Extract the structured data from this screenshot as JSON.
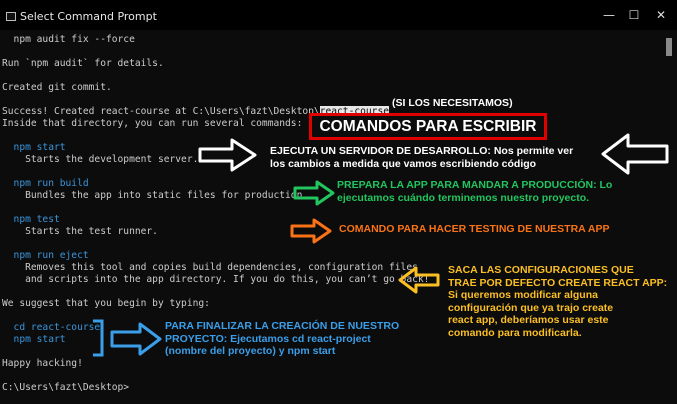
{
  "window": {
    "title": "Select Command Prompt",
    "minimize": "—",
    "maximize": "☐",
    "close": "✕"
  },
  "terminal": {
    "lines": [
      {
        "text": "  npm audit fix --force",
        "type": "out"
      },
      {
        "text": "",
        "type": "blank"
      },
      {
        "text": "Run `npm audit` for details.",
        "type": "out"
      },
      {
        "text": "",
        "type": "blank"
      },
      {
        "text": "Created git commit.",
        "type": "out"
      },
      {
        "text": "",
        "type": "blank"
      },
      {
        "text": "Success! Created react-course at C:\\Users\\fazt\\Desktop\\",
        "type": "out",
        "selected": "react-course"
      },
      {
        "text": "Inside that directory, you can run several commands:",
        "type": "out"
      },
      {
        "text": "",
        "type": "blank"
      },
      {
        "text": "  npm start",
        "type": "cmd"
      },
      {
        "text": "    Starts the development server.",
        "type": "out"
      },
      {
        "text": "",
        "type": "blank"
      },
      {
        "text": "  npm run build",
        "type": "cmd"
      },
      {
        "text": "    Bundles the app into static files for production.",
        "type": "out"
      },
      {
        "text": "",
        "type": "blank"
      },
      {
        "text": "  npm test",
        "type": "cmd"
      },
      {
        "text": "    Starts the test runner.",
        "type": "out"
      },
      {
        "text": "",
        "type": "blank"
      },
      {
        "text": "  npm run eject",
        "type": "cmd"
      },
      {
        "text": "    Removes this tool and copies build dependencies, configuration files",
        "type": "out"
      },
      {
        "text": "    and scripts into the app directory. If you do this, you can’t go back!",
        "type": "out"
      },
      {
        "text": "",
        "type": "blank"
      },
      {
        "text": "We suggest that you begin by typing:",
        "type": "out"
      },
      {
        "text": "",
        "type": "blank"
      },
      {
        "text": "  cd react-course",
        "type": "cmd"
      },
      {
        "text": "  npm start",
        "type": "cmd"
      },
      {
        "text": "",
        "type": "blank"
      },
      {
        "text": "Happy hacking!",
        "type": "out"
      },
      {
        "text": "",
        "type": "blank"
      },
      {
        "text": "C:\\Users\\fazt\\Desktop>",
        "type": "out"
      }
    ]
  },
  "annotations": {
    "optional_note": "(SI LOS NECESITAMOS)",
    "title": "COMANDOS PARA ESCRIBIR",
    "start_note": [
      "EJECUTA UN SERVIDOR DE DESARROLLO: Nos permite ver",
      "los cambios a medida que vamos escribiendo código"
    ],
    "build_note": [
      "PREPARA LA APP PARA MANDAR A PRODUCCIÓN: Lo",
      "ejecutamos cuándo terminemos nuestro proyecto."
    ],
    "test_note": [
      "COMANDO PARA HACER TESTING DE NUESTRA APP"
    ],
    "eject_note": [
      "SACA LAS CONFIGURACIONES QUE",
      "TRAE POR DEFECTO CREATE REACT APP:",
      "Si queremos modificar alguna",
      "configuración que ya trajo create",
      "react app, deberíamos usar este",
      "comando para modificarla."
    ],
    "finish_note": [
      "PARA FINALIZAR LA CREACIÓN DE NUESTRO",
      "PROYECTO: Ejecutamos cd react-project",
      "(nombre del proyecto) y npm start"
    ]
  },
  "colors": {
    "white": "#ffffff",
    "green": "#22c55e",
    "orange": "#f97316",
    "yellow": "#fbbf24",
    "blue": "#3b9ee8",
    "red": "#e00000"
  }
}
